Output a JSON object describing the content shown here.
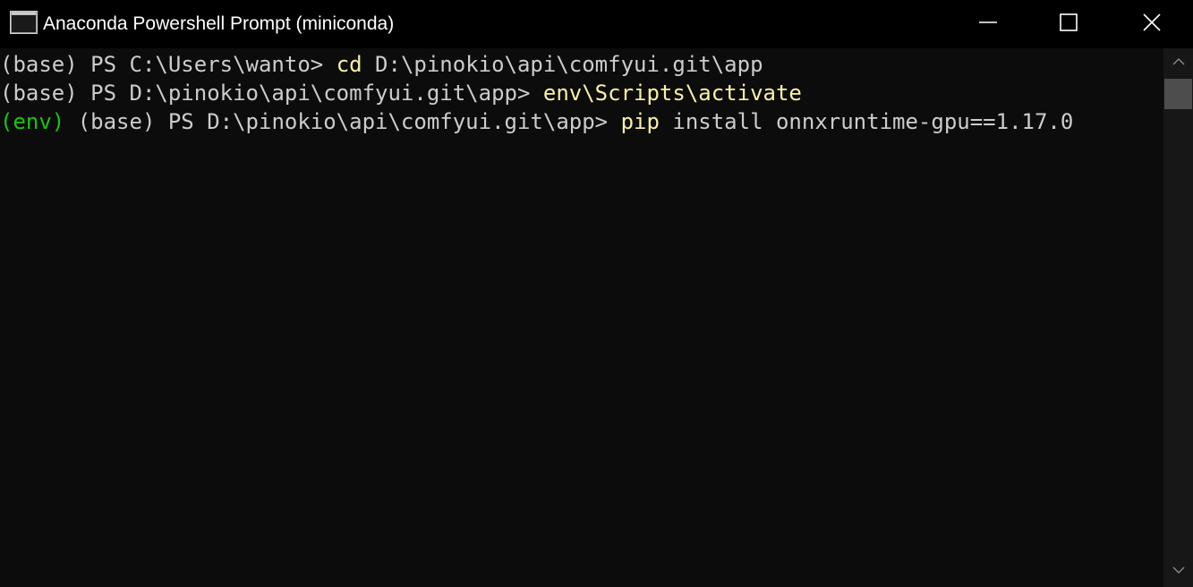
{
  "window": {
    "title": "Anaconda Powershell Prompt (miniconda)",
    "icon": "terminal-icon"
  },
  "controls": {
    "minimize_icon": "minimize-icon",
    "maximize_icon": "maximize-icon",
    "close_icon": "close-icon"
  },
  "console": {
    "lines": [
      {
        "prompt": "(base) PS C:\\Users\\wanto> ",
        "command": "cd",
        "args": " D:\\pinokio\\api\\comfyui.git\\app"
      },
      {
        "prompt": "(base) PS D:\\pinokio\\api\\comfyui.git\\app> ",
        "command": "env\\Scripts\\activate",
        "args": ""
      },
      {
        "env": "(env)",
        "prompt": " (base) PS D:\\pinokio\\api\\comfyui.git\\app> ",
        "command": "pip",
        "args": " install onnxruntime-gpu==1.17.0"
      }
    ]
  },
  "scrollbar": {
    "up_icon": "scroll-up-arrow-icon",
    "down_icon": "scroll-down-arrow-icon"
  },
  "colors": {
    "background": "#0c0c0c",
    "titlebar": "#000000",
    "text": "#cccccc",
    "command": "#f9f1a5",
    "env": "#16c60c",
    "scroll_thumb": "#4d4d4d"
  }
}
